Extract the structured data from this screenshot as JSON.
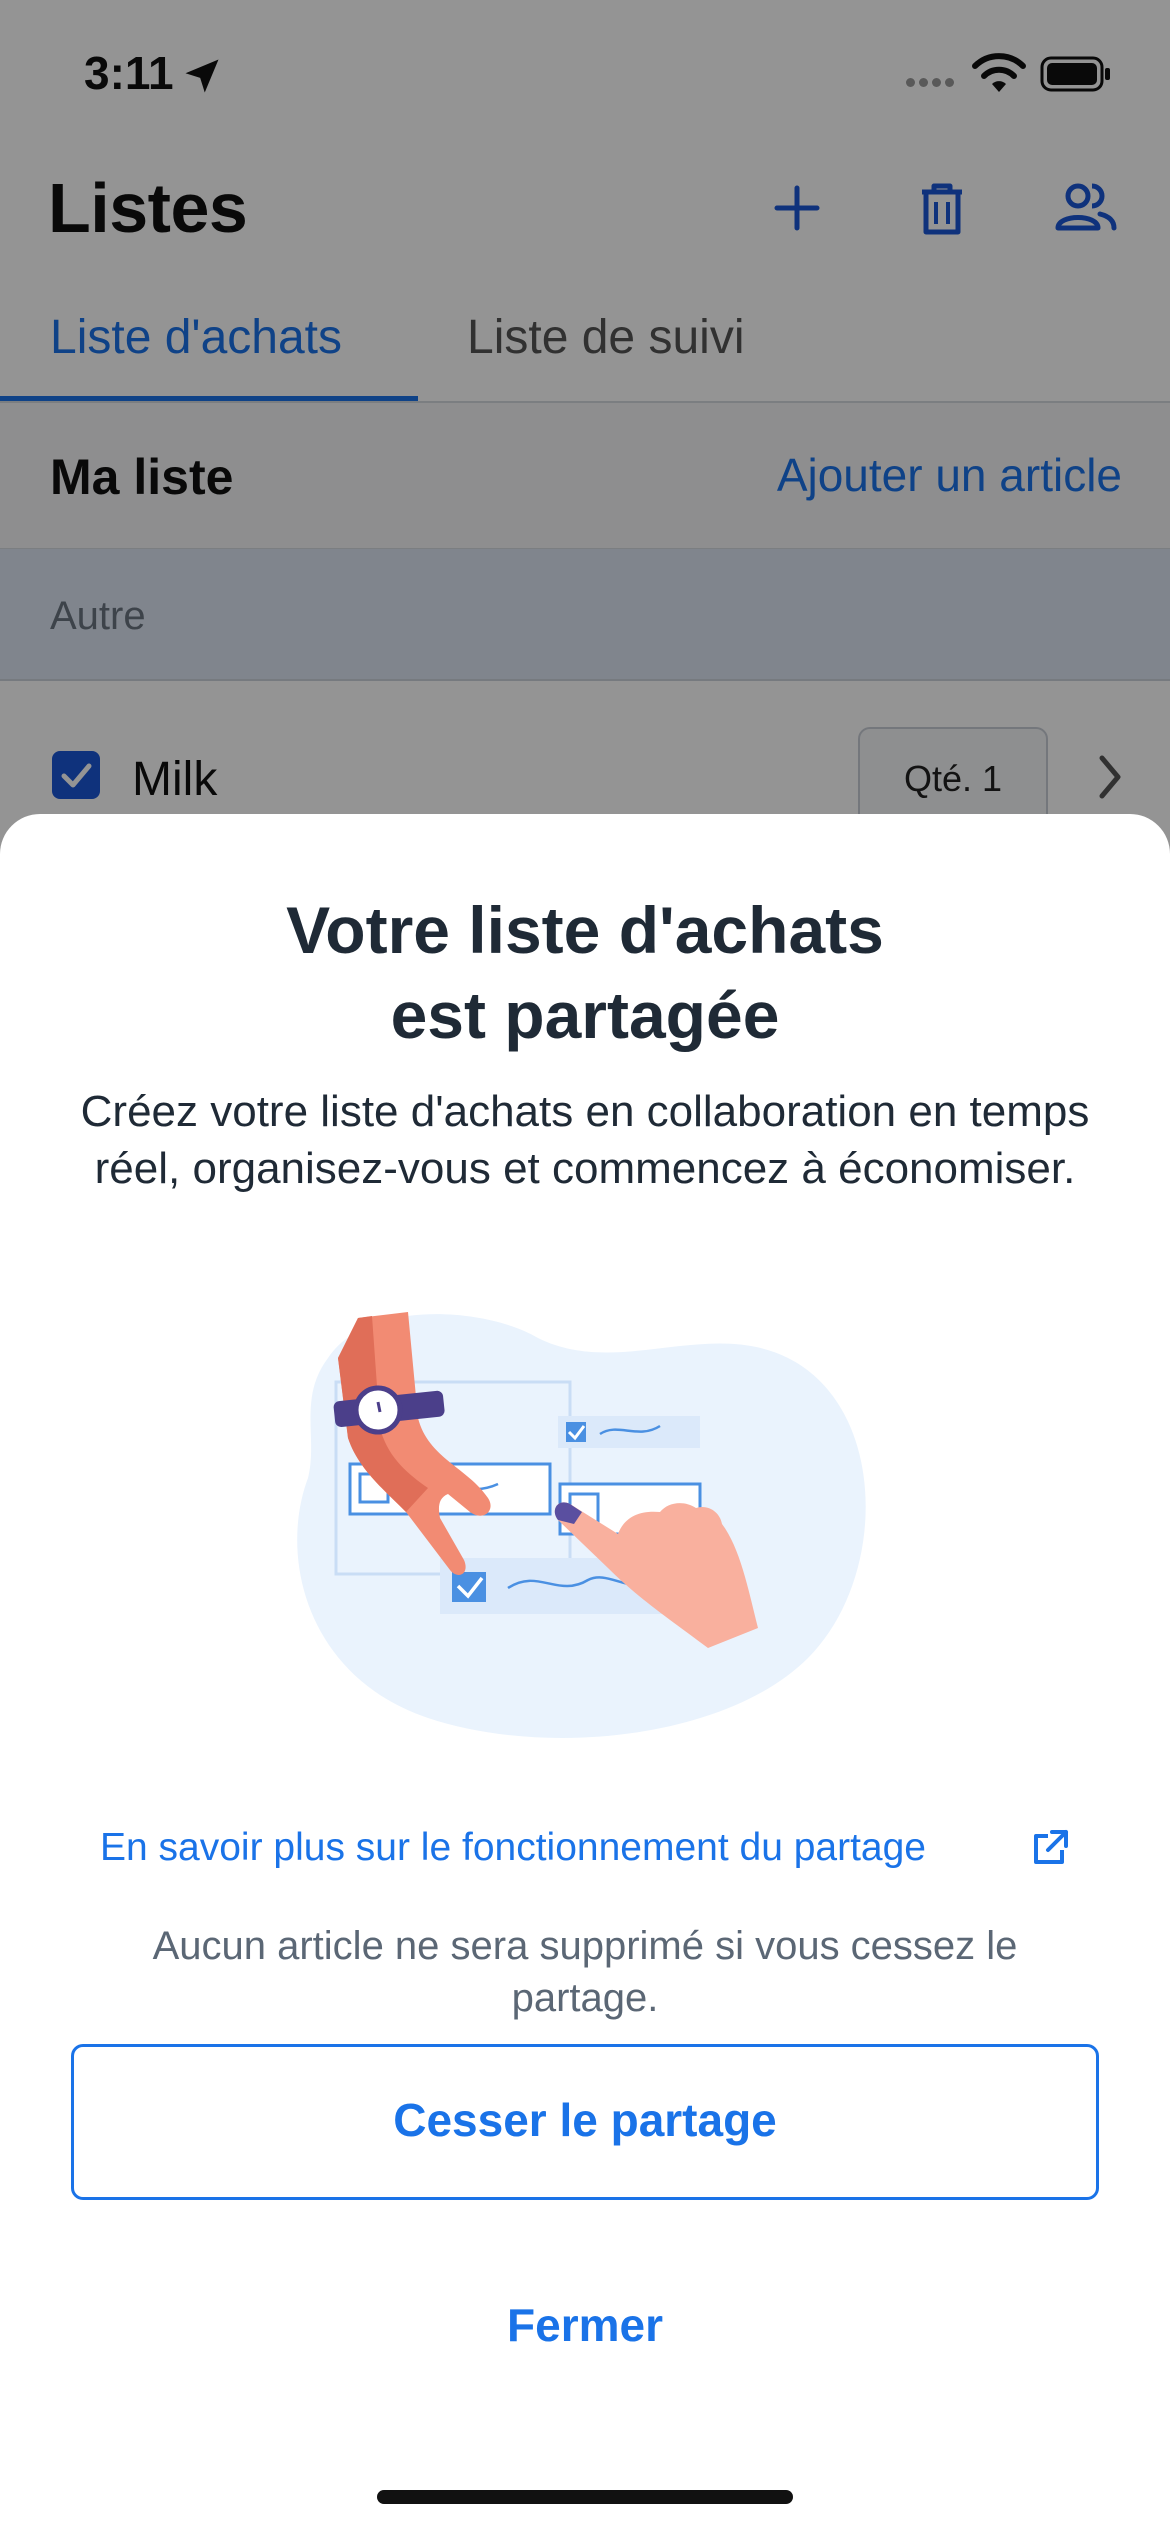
{
  "status_bar": {
    "time": "3:11",
    "icons": [
      "location-arrow-icon",
      "cellular-signal-icon",
      "wifi-icon",
      "battery-icon"
    ]
  },
  "header": {
    "title": "Listes",
    "actions": [
      {
        "name": "add-icon"
      },
      {
        "name": "trash-icon"
      },
      {
        "name": "share-people-icon"
      }
    ]
  },
  "tabs": [
    {
      "label": "Liste d'achats",
      "active": true
    },
    {
      "label": "Liste de suivi",
      "active": false
    }
  ],
  "list": {
    "name": "Ma liste",
    "add_item_label": "Ajouter un article",
    "section_label": "Autre",
    "items": [
      {
        "label": "Milk",
        "checked": true,
        "quantity": "Qté. 1"
      }
    ]
  },
  "sheet": {
    "title_line1": "Votre liste d'achats",
    "title_line2": "est partagée",
    "description": "Créez votre liste d'achats en collaboration en temps réel, organisez-vous et commencez à économiser.",
    "learn_more_link": "En savoir plus sur le fonctionnement du partage",
    "disclaimer": "Aucun article ne sera supprimé si vous cessez le partage.",
    "stop_sharing_button": "Cesser le partage",
    "close_button": "Fermer"
  },
  "colors": {
    "accent": "#1a73e8",
    "checkbox": "#1a56d6",
    "title_text": "#1f2a36",
    "muted_text": "#5b6775",
    "scrim": "rgba(0,0,0,0.42)"
  }
}
